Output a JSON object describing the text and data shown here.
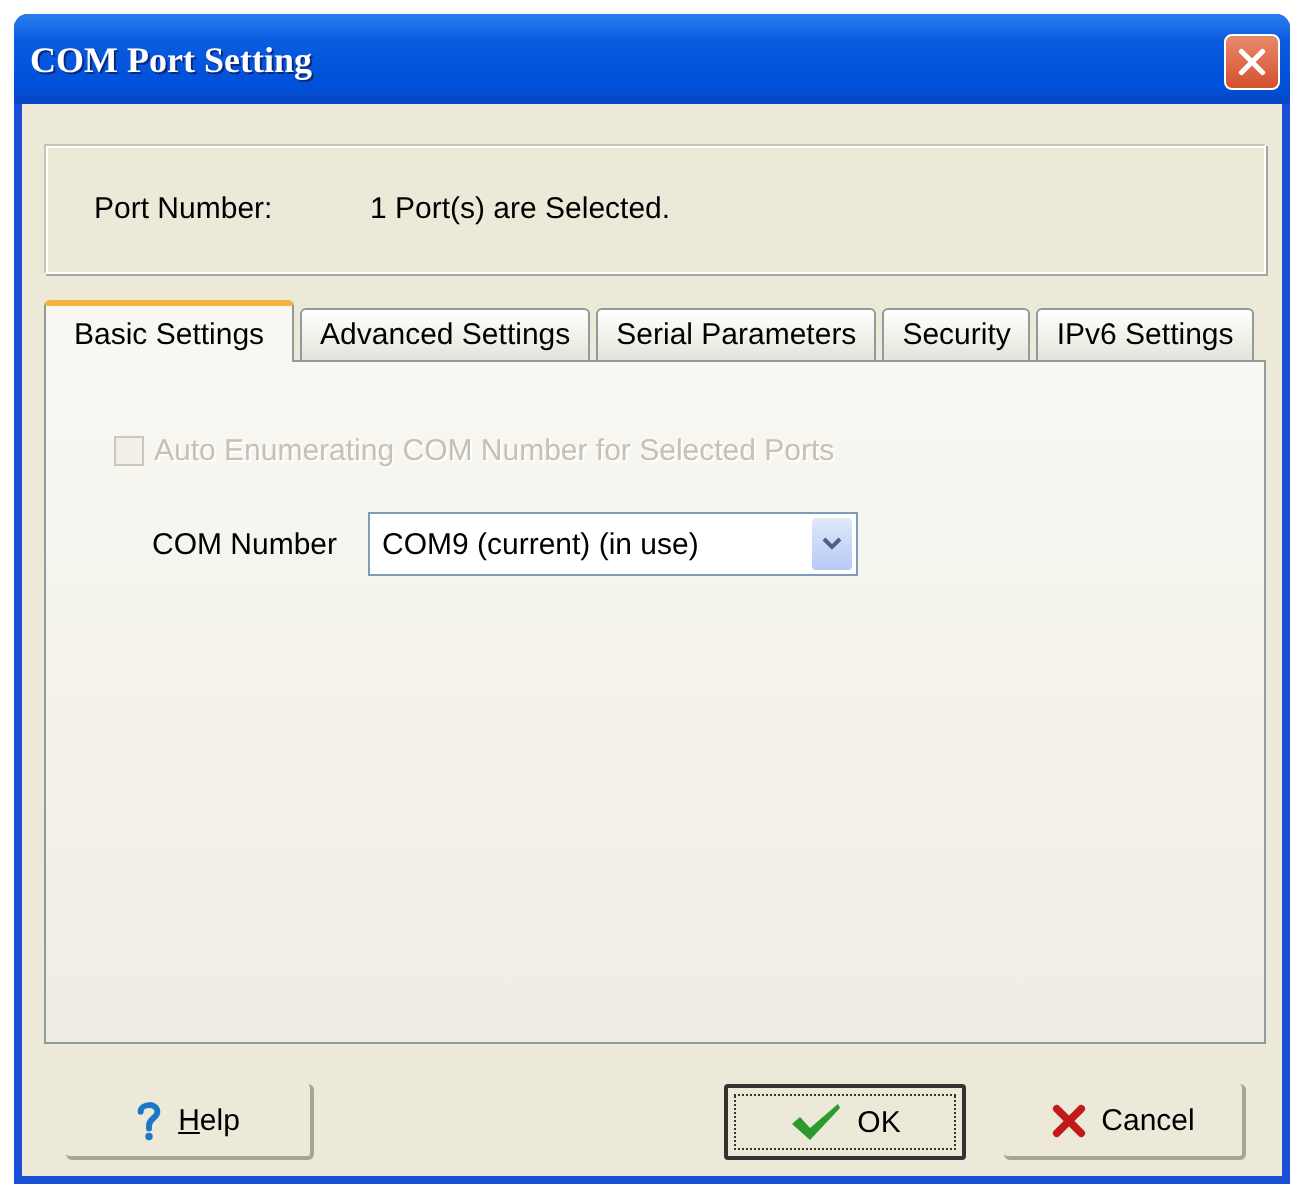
{
  "window": {
    "title": "COM Port Setting"
  },
  "port_info": {
    "label": "Port Number:",
    "value": "1 Port(s) are Selected."
  },
  "tabs": [
    {
      "label": "Basic Settings",
      "selected": true
    },
    {
      "label": "Advanced Settings",
      "selected": false
    },
    {
      "label": "Serial Parameters",
      "selected": false
    },
    {
      "label": "Security",
      "selected": false
    },
    {
      "label": "IPv6 Settings",
      "selected": false
    }
  ],
  "basic_settings": {
    "auto_enumerate": {
      "label": "Auto Enumerating COM Number for Selected Ports",
      "checked": false,
      "disabled": true
    },
    "com_number": {
      "label": "COM Number",
      "value": "COM9 (current) (in use)"
    }
  },
  "buttons": [
    {
      "kind": "help",
      "label": "Help",
      "default": false,
      "underlined_first_letter": true
    },
    {
      "kind": "ok",
      "label": "OK",
      "default": true,
      "underlined_first_letter": false
    },
    {
      "kind": "cancel",
      "label": "Cancel",
      "default": false,
      "underlined_first_letter": false
    }
  ]
}
